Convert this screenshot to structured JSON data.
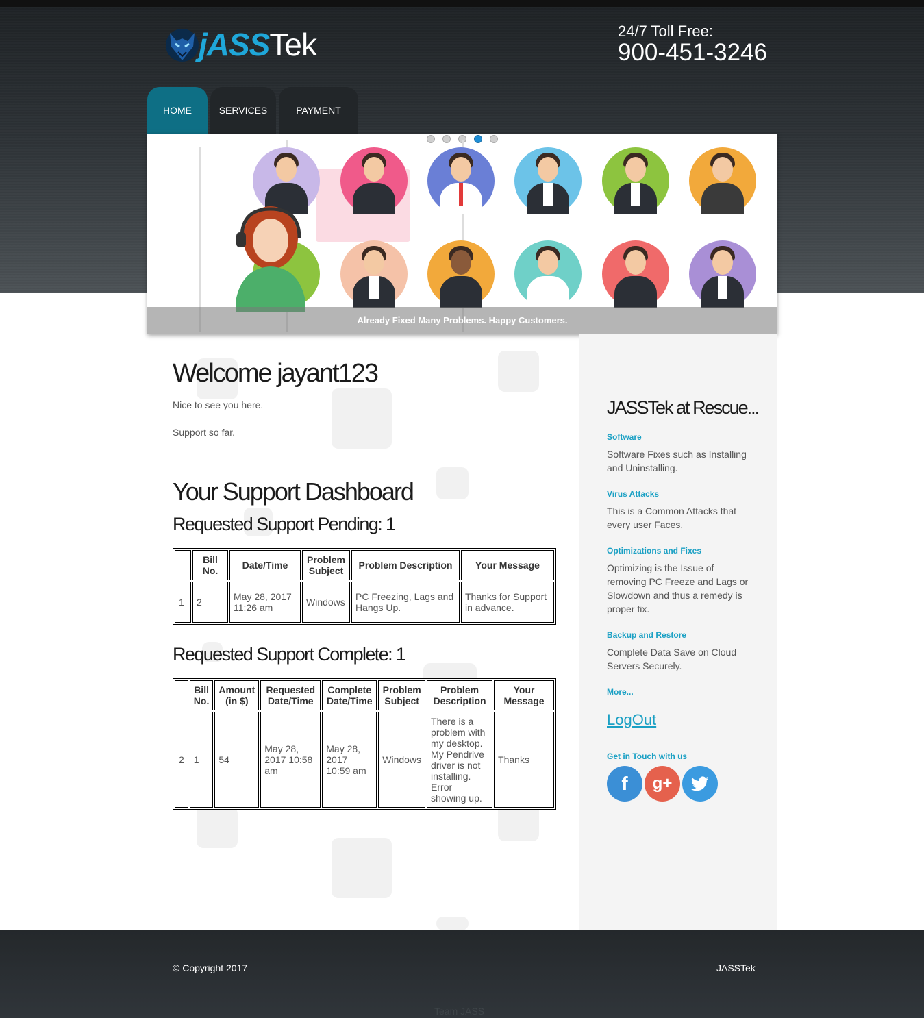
{
  "header": {
    "logo_j": "jASS",
    "logo_tek": "Tek",
    "toll_label": "24/7 Toll Free:",
    "toll_number": "900-451-3246"
  },
  "nav": {
    "tabs": [
      {
        "label": "HOME",
        "active": true
      },
      {
        "label": "SERVICES",
        "active": false
      },
      {
        "label": "PAYMENT",
        "active": false
      }
    ]
  },
  "slider": {
    "caption": "Already Fixed Many Problems. Happy Customers.",
    "active_dot": 4,
    "dot_count": 5
  },
  "main": {
    "welcome": "Welcome jayant123",
    "greeting": "Nice to see you here.",
    "support_so_far": "Support so far.",
    "dashboard_title": "Your Support Dashboard",
    "pending_title": "Requested Support Pending: 1",
    "pending_table": {
      "headers": [
        "",
        "Bill No.",
        "Date/Time",
        "Problem Subject",
        "Problem Description",
        "Your Message"
      ],
      "rows": [
        [
          "1",
          "2",
          "May 28, 2017 11:26 am",
          "Windows",
          "PC Freezing, Lags and Hangs Up.",
          "Thanks for Support in advance."
        ]
      ]
    },
    "complete_title": "Requested Support Complete: 1",
    "complete_table": {
      "headers": [
        "",
        "Bill No.",
        "Amount (in $)",
        "Requested Date/Time",
        "Complete Date/Time",
        "Problem Subject",
        "Problem Description",
        "Your Message"
      ],
      "rows": [
        [
          "2",
          "1",
          "54",
          "May 28, 2017 10:58 am",
          "May 28, 2017 10:59 am",
          "Windows",
          "There is a problem with my desktop. My Pendrive driver is not installing. Error showing up.",
          "Thanks"
        ]
      ]
    }
  },
  "sidebar": {
    "title": "JASSTek at Rescue...",
    "items": [
      {
        "heading": "Software",
        "text": "Software Fixes such as Installing and Uninstalling."
      },
      {
        "heading": "Virus Attacks",
        "text": "This is a Common Attacks that every user Faces."
      },
      {
        "heading": "Optimizations and Fixes",
        "text": "Optimizing is the Issue of removing PC Freeze and Lags or Slowdown and thus a remedy is proper fix."
      },
      {
        "heading": "Backup and Restore",
        "text": "Complete Data Save on Cloud Servers Securely."
      }
    ],
    "more": "More...",
    "logout": "LogOut",
    "get_in_touch": "Get in Touch with us",
    "social": [
      {
        "name": "facebook",
        "glyph": "f",
        "color": "#3b8fd6"
      },
      {
        "name": "google-plus",
        "glyph": "g+",
        "color": "#e5614d"
      },
      {
        "name": "twitter",
        "glyph": "t",
        "color": "#3b9be0"
      }
    ]
  },
  "footer": {
    "copyright": "© Copyright 2017",
    "brand": "JASSTek",
    "team": "Team JASS"
  }
}
